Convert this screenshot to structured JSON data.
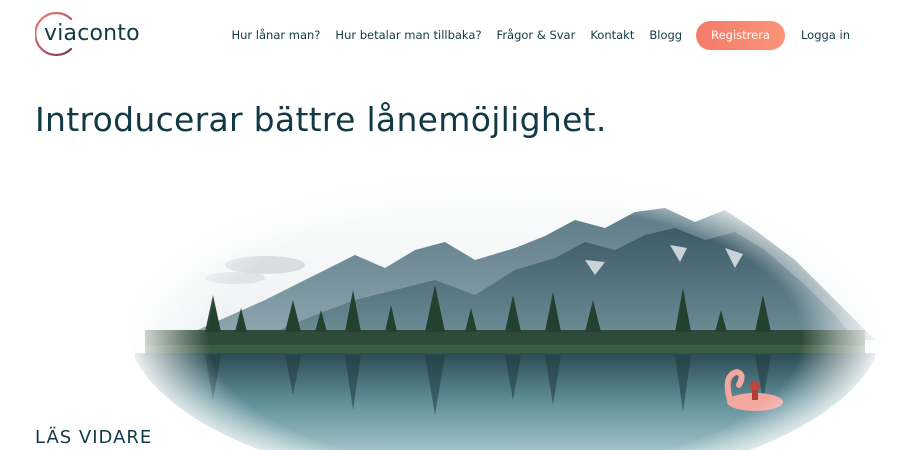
{
  "brand": {
    "name": "viaconto"
  },
  "nav": {
    "items": [
      {
        "label": "Hur lånar man?"
      },
      {
        "label": "Hur betalar man tillbaka?"
      },
      {
        "label": "Frågor & Svar"
      },
      {
        "label": "Kontakt"
      },
      {
        "label": "Blogg"
      }
    ],
    "register_label": "Registrera",
    "login_label": "Logga in"
  },
  "hero": {
    "title": "Introducerar bättre lånemöjlighet.",
    "read_more_label": "LÄS VIDARE"
  },
  "colors": {
    "text": "#123a46",
    "accent_start": "#f47a6a",
    "accent_end": "#fb9576"
  }
}
